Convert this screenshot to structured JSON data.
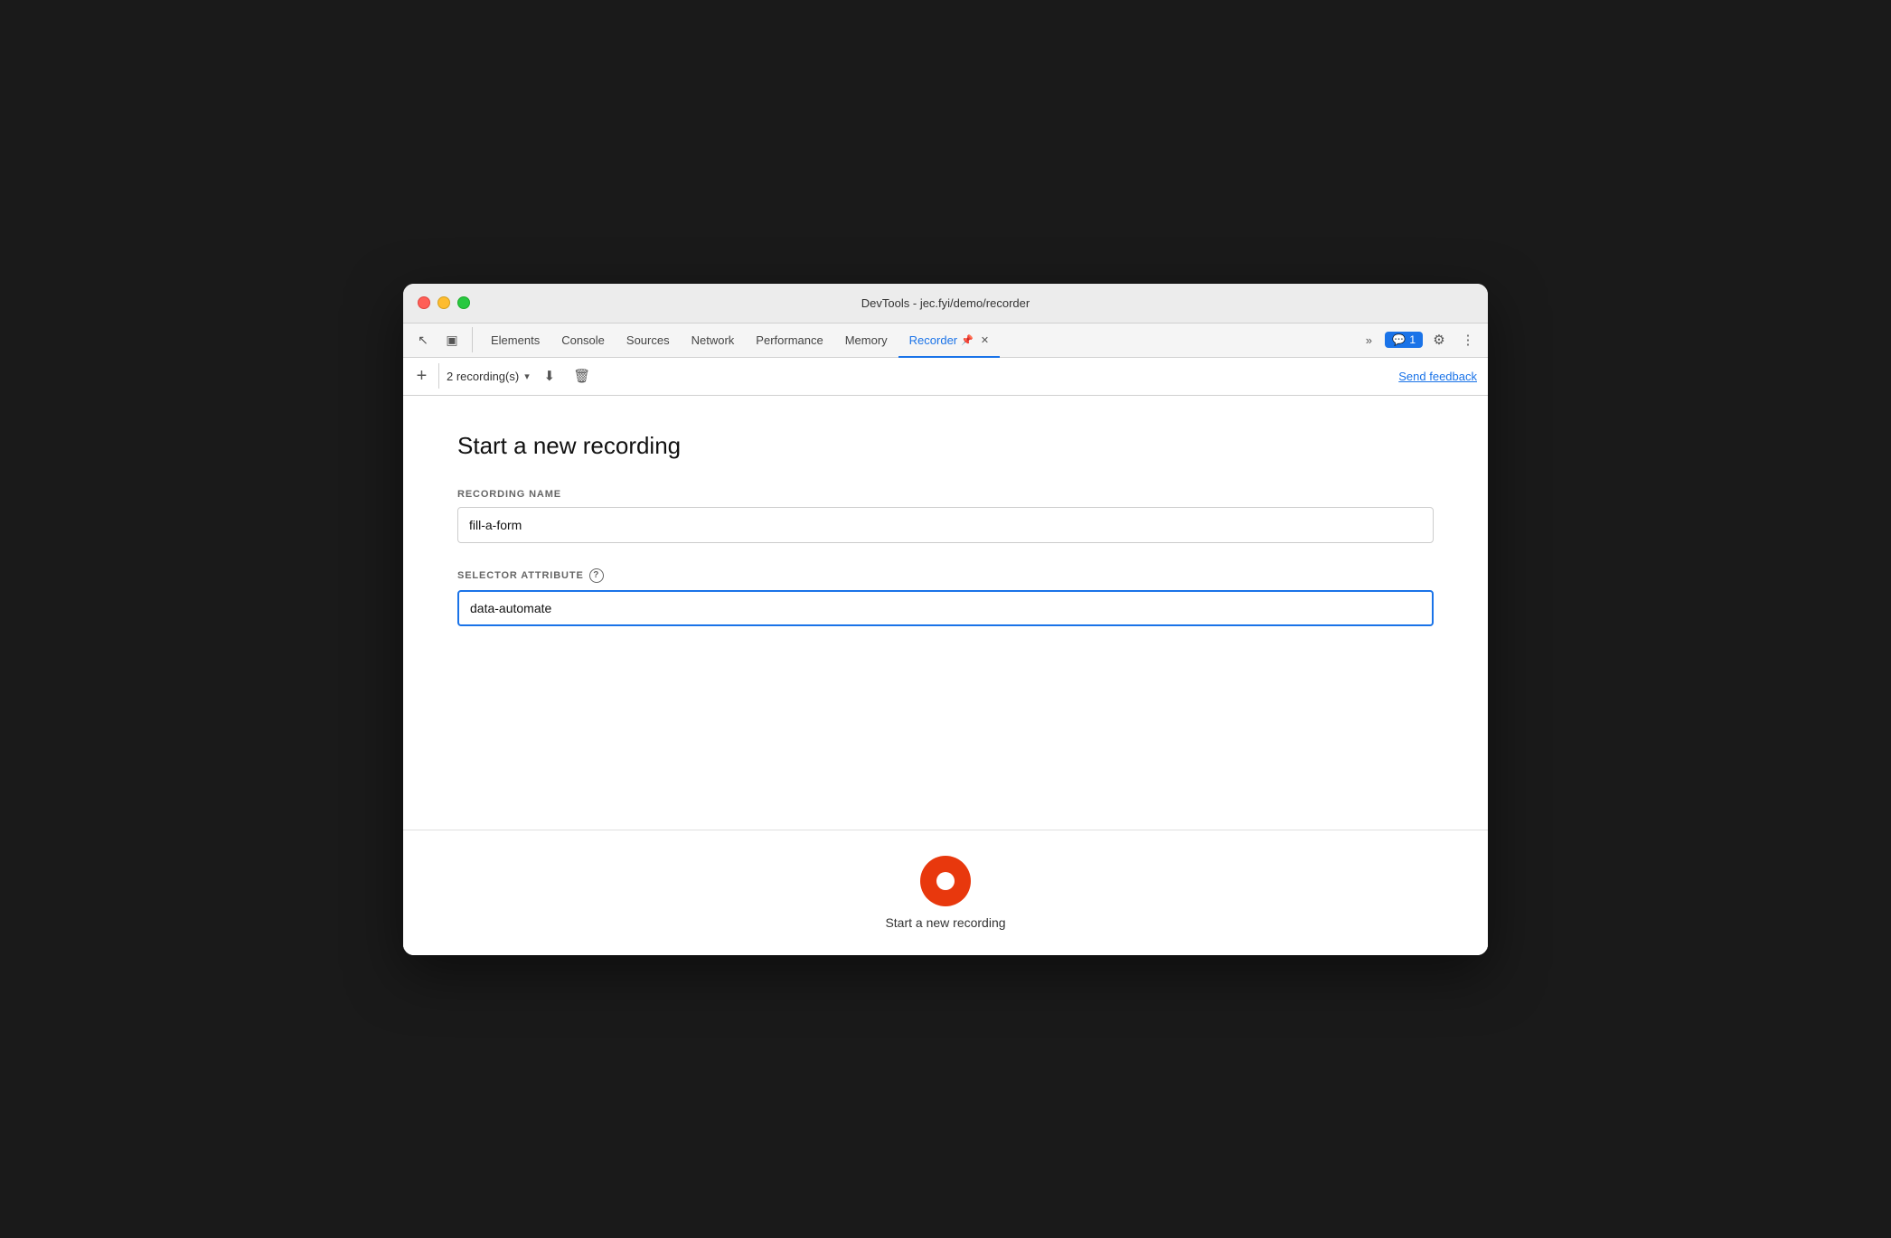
{
  "window": {
    "title": "DevTools - jec.fyi/demo/recorder"
  },
  "traffic_lights": {
    "close": "close",
    "minimize": "minimize",
    "maximize": "maximize"
  },
  "tabs": [
    {
      "id": "elements",
      "label": "Elements",
      "active": false
    },
    {
      "id": "console",
      "label": "Console",
      "active": false
    },
    {
      "id": "sources",
      "label": "Sources",
      "active": false
    },
    {
      "id": "network",
      "label": "Network",
      "active": false
    },
    {
      "id": "performance",
      "label": "Performance",
      "active": false
    },
    {
      "id": "memory",
      "label": "Memory",
      "active": false
    },
    {
      "id": "recorder",
      "label": "Recorder",
      "active": true
    }
  ],
  "tab_right": {
    "more_label": "»",
    "badge_count": "1",
    "settings_icon": "⚙",
    "more_icon": "⋮"
  },
  "toolbar": {
    "add_label": "+",
    "recording_count": "2 recording(s)",
    "chevron": "▾",
    "download_title": "Export recording",
    "delete_title": "Delete recording",
    "send_feedback": "Send feedback"
  },
  "main": {
    "page_title": "Start a new recording",
    "recording_name_label": "RECORDING NAME",
    "recording_name_value": "fill-a-form",
    "recording_name_placeholder": "Recording name",
    "selector_attribute_label": "SELECTOR ATTRIBUTE",
    "selector_attribute_help": "?",
    "selector_attribute_value": "data-automate",
    "selector_attribute_placeholder": "Selector attribute"
  },
  "record_area": {
    "button_title": "Start a new recording",
    "label": "Start a new recording"
  },
  "icons": {
    "cursor": "↖",
    "device": "⬚",
    "pin": "📌"
  }
}
